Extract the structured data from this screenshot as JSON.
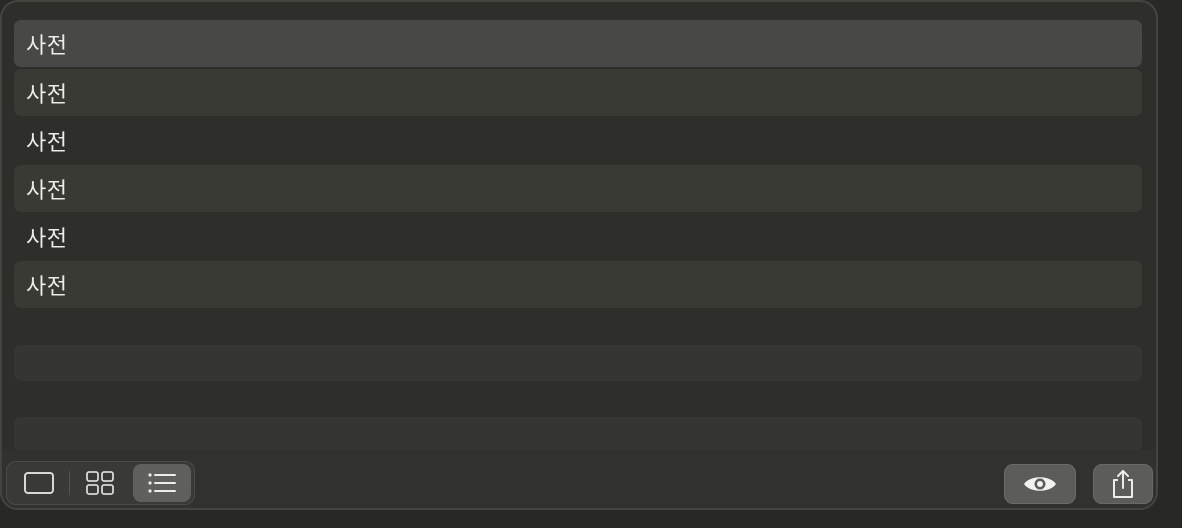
{
  "list": {
    "items": [
      {
        "label": "사전"
      },
      {
        "label": "사전"
      },
      {
        "label": "사전"
      },
      {
        "label": "사전"
      },
      {
        "label": "사전"
      },
      {
        "label": "사전"
      }
    ]
  },
  "toolbar": {
    "view_modes": [
      {
        "icon": "single-view-icon",
        "active": false
      },
      {
        "icon": "grid-view-icon",
        "active": false
      },
      {
        "icon": "list-view-icon",
        "active": true
      }
    ],
    "right_buttons": [
      {
        "icon": "eye-icon"
      },
      {
        "icon": "share-icon"
      }
    ]
  },
  "colors": {
    "background": "#2e2e2b",
    "row_selected": "#484847",
    "row_alt": "#3a3a35",
    "text": "#ececea"
  }
}
